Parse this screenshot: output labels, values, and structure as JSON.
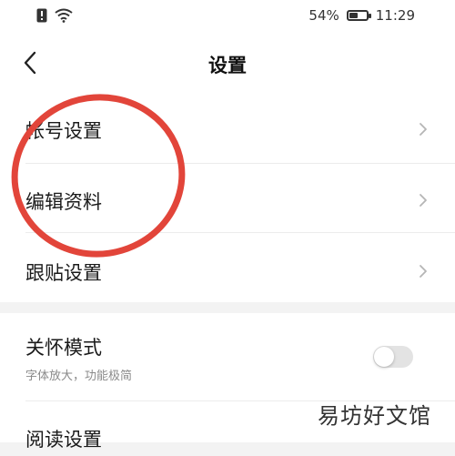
{
  "status_bar": {
    "battery_percent": "54%",
    "battery_level": 0.54,
    "time": "11:29"
  },
  "nav": {
    "title": "设置",
    "back_icon": "chevron-left-icon"
  },
  "group1": {
    "items": [
      {
        "label": "帐号设置"
      },
      {
        "label": "编辑资料"
      },
      {
        "label": "跟贴设置"
      }
    ]
  },
  "group2": {
    "care_mode": {
      "label": "关怀模式",
      "sublabel": "字体放大，功能极简",
      "enabled": false
    },
    "reading": {
      "label": "阅读设置"
    }
  },
  "watermark": "易坊好文馆",
  "colors": {
    "annotation_red": "#e2453a",
    "background": "#f3f3f3",
    "toggle_off": "#e3e3e3"
  }
}
